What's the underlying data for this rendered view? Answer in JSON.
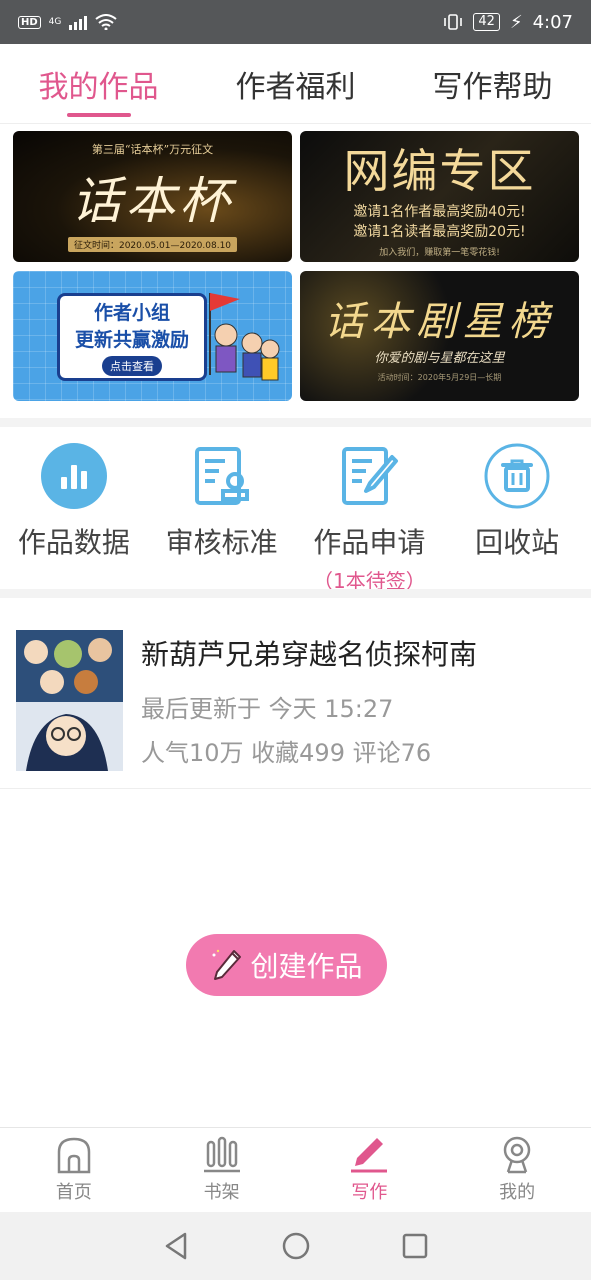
{
  "status_bar": {
    "hd": "HD",
    "signal": "4G",
    "battery": "42",
    "time": "4:07"
  },
  "tabs": [
    {
      "label": "我的作品",
      "active": true
    },
    {
      "label": "作者福利",
      "active": false
    },
    {
      "label": "写作帮助",
      "active": false
    }
  ],
  "banners": {
    "b1": {
      "top": "第三届“话本杯”万元征文",
      "main": "话本杯",
      "date": "征文时间：2020.05.01—2020.08.10"
    },
    "b2": {
      "main": "网编专区",
      "line1": "邀请1名作者最高奖励40元!",
      "line2": "邀请1名读者最高奖励20元!",
      "small": "加入我们，赚取第一笔零花钱!"
    },
    "b3": {
      "line1": "作者小组",
      "line2": "更新共赢激励",
      "button": "点击查看"
    },
    "b4": {
      "main": "话本剧星榜",
      "sub": "你爱的剧与星都在这里",
      "small": "活动时间：2020年5月29日—长期"
    }
  },
  "quick_actions": [
    {
      "label": "作品数据",
      "icon": "bar-chart-icon"
    },
    {
      "label": "审核标准",
      "icon": "document-stamp-icon"
    },
    {
      "label": "作品申请",
      "icon": "edit-document-icon",
      "sub": "（1本待签）"
    },
    {
      "label": "回收站",
      "icon": "trash-icon"
    }
  ],
  "work": {
    "title": "新葫芦兄弟穿越名侦探柯南",
    "updated": "最后更新于 今天 15:27",
    "stats": "人气10万 收藏499 评论76"
  },
  "create_button": "创建作品",
  "bottom_nav": [
    {
      "label": "首页",
      "icon": "home-icon",
      "active": false
    },
    {
      "label": "书架",
      "icon": "bookshelf-icon",
      "active": false
    },
    {
      "label": "写作",
      "icon": "pen-icon",
      "active": true
    },
    {
      "label": "我的",
      "icon": "profile-icon",
      "active": false
    }
  ],
  "colors": {
    "accent": "#e0578d",
    "button": "#f27ab0",
    "icon_blue": "#5ab4e5"
  }
}
